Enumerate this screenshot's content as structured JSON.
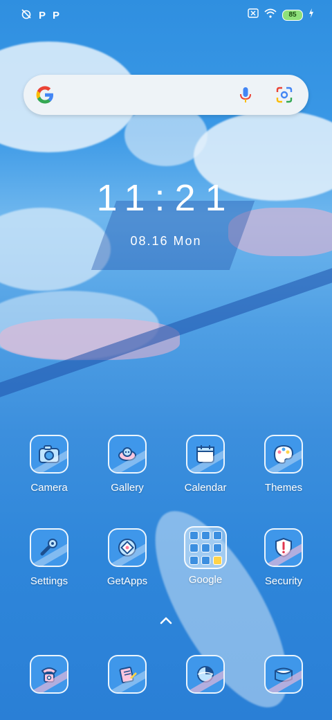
{
  "status_bar": {
    "left_icons": [
      "alarm-off-icon",
      "p-icon",
      "p-icon"
    ],
    "battery_level": "85",
    "right_icons": [
      "sim-off-icon",
      "wifi-icon",
      "battery-icon",
      "charging-icon"
    ]
  },
  "search_bar": {
    "logo": "google-g-icon",
    "mic": "mic-icon",
    "lens": "lens-icon"
  },
  "clock": {
    "time": "11:21",
    "date": "08.16 Mon"
  },
  "apps_row1": [
    {
      "label": "Camera",
      "icon": "camera-icon"
    },
    {
      "label": "Gallery",
      "icon": "gallery-icon"
    },
    {
      "label": "Calendar",
      "icon": "calendar-icon"
    },
    {
      "label": "Themes",
      "icon": "themes-icon"
    }
  ],
  "apps_row2": [
    {
      "label": "Settings",
      "icon": "settings-icon"
    },
    {
      "label": "GetApps",
      "icon": "getapps-icon"
    },
    {
      "label": "Google",
      "icon": "google-folder-icon"
    },
    {
      "label": "Security",
      "icon": "security-icon"
    }
  ],
  "dock": [
    {
      "icon": "phone-icon"
    },
    {
      "icon": "notes-icon"
    },
    {
      "icon": "browser-icon"
    },
    {
      "icon": "messages-icon"
    }
  ],
  "colors": {
    "accent": "#3f97ea",
    "battery": "#8ee07a"
  }
}
